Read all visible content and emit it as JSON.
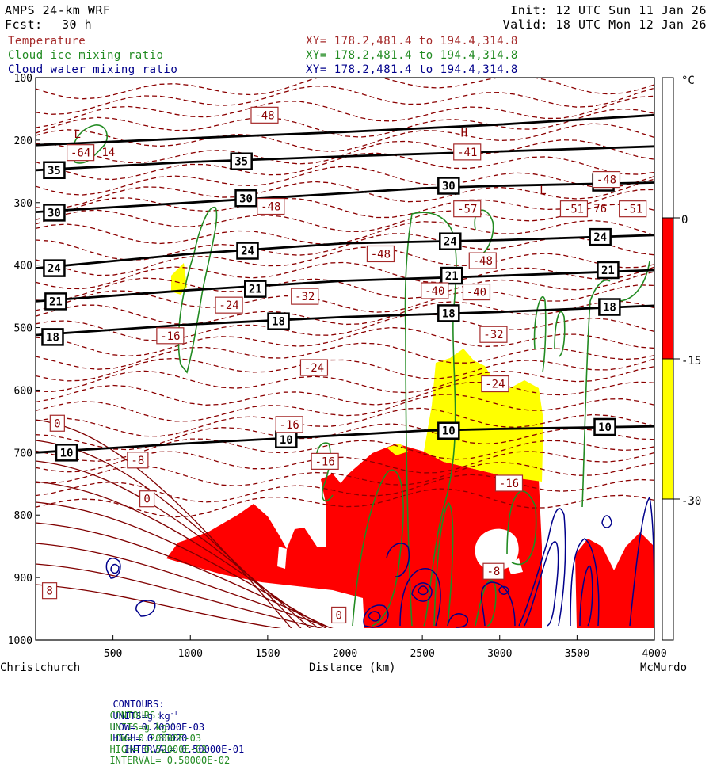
{
  "header": {
    "model": "AMPS 24-km WRF",
    "forecast_label": "Fcst:",
    "forecast_value": "30 h",
    "init": "Init: 12 UTC Sun 11 Jan 26",
    "valid": "Valid: 18 UTC Mon 12 Jan 26",
    "fields": [
      {
        "name": "Temperature",
        "xy": "XY= 178.2,481.4 to 194.4,314.8",
        "color": "#a52a2a"
      },
      {
        "name": "Cloud ice mixing ratio",
        "xy": "XY= 178.2,481.4 to 194.4,314.8",
        "color": "#228b22"
      },
      {
        "name": "Cloud water mixing ratio",
        "xy": "XY= 178.2,481.4 to 194.4,314.8",
        "color": "#00008b"
      }
    ]
  },
  "chart_data": {
    "type": "cross-section",
    "xlabel": "Distance (km)",
    "ylabel": "",
    "x_ticks": [
      500,
      1000,
      1500,
      2000,
      2500,
      3000,
      3500,
      4000
    ],
    "xlim": [
      0,
      4000
    ],
    "x_endpoints": {
      "left": "Christchurch",
      "right": "McMurdo"
    },
    "y_ticks": [
      100,
      200,
      300,
      400,
      500,
      600,
      700,
      800,
      900,
      1000
    ],
    "ylim": [
      100,
      1000
    ],
    "temperature_fill_legend": {
      "unit": "°C",
      "levels": [
        0,
        -15,
        -30
      ],
      "colors": {
        "0_to_-15": "#ff0000",
        "-15_to_-30": "#ffff00",
        "above_0": "#ffffff",
        "below_-30": "#ffffff"
      }
    },
    "theta_lines": [
      {
        "label": "35",
        "points": [
          [
            0,
            208
          ],
          [
            1000,
            197
          ],
          [
            2000,
            187
          ],
          [
            3000,
            175
          ],
          [
            4000,
            160
          ]
        ]
      },
      {
        "label": "35",
        "points": [
          [
            0,
            248
          ],
          [
            1000,
            235
          ],
          [
            2000,
            226
          ],
          [
            3000,
            218
          ],
          [
            4000,
            210
          ]
        ]
      },
      {
        "label": "30",
        "points": [
          [
            0,
            315
          ],
          [
            1000,
            300
          ],
          [
            2000,
            285
          ],
          [
            2500,
            277
          ],
          [
            3000,
            273
          ],
          [
            4000,
            268
          ]
        ]
      },
      {
        "label": "24",
        "points": [
          [
            0,
            405
          ],
          [
            1000,
            382
          ],
          [
            2000,
            365
          ],
          [
            3000,
            360
          ],
          [
            4000,
            352
          ]
        ]
      },
      {
        "label": "21",
        "points": [
          [
            0,
            458
          ],
          [
            1000,
            440
          ],
          [
            2000,
            425
          ],
          [
            3000,
            417
          ],
          [
            4000,
            408
          ]
        ]
      },
      {
        "label": "18",
        "points": [
          [
            0,
            512
          ],
          [
            1000,
            495
          ],
          [
            2000,
            483
          ],
          [
            3000,
            475
          ],
          [
            4000,
            465
          ]
        ]
      },
      {
        "label": "10",
        "points": [
          [
            0,
            700
          ],
          [
            1000,
            685
          ],
          [
            2000,
            672
          ],
          [
            2500,
            665
          ],
          [
            3000,
            662
          ],
          [
            4000,
            658
          ]
        ]
      }
    ],
    "theta_label_positions": [
      {
        "text": "35",
        "x": 120,
        "p": 248
      },
      {
        "text": "35",
        "x": 1330,
        "p": 234
      },
      {
        "text": "30",
        "x": 120,
        "p": 316
      },
      {
        "text": "30",
        "x": 1360,
        "p": 293
      },
      {
        "text": "30",
        "x": 2670,
        "p": 273
      },
      {
        "text": "30",
        "x": 3670,
        "p": 268
      },
      {
        "text": "24",
        "x": 120,
        "p": 405
      },
      {
        "text": "24",
        "x": 1370,
        "p": 377
      },
      {
        "text": "24",
        "x": 2680,
        "p": 362
      },
      {
        "text": "24",
        "x": 3650,
        "p": 355
      },
      {
        "text": "21",
        "x": 130,
        "p": 458
      },
      {
        "text": "21",
        "x": 1420,
        "p": 438
      },
      {
        "text": "21",
        "x": 2690,
        "p": 417
      },
      {
        "text": "21",
        "x": 3700,
        "p": 408
      },
      {
        "text": "18",
        "x": 110,
        "p": 515
      },
      {
        "text": "18",
        "x": 1570,
        "p": 490
      },
      {
        "text": "18",
        "x": 2670,
        "p": 477
      },
      {
        "text": "18",
        "x": 3710,
        "p": 467
      },
      {
        "text": "10",
        "x": 200,
        "p": 700
      },
      {
        "text": "10",
        "x": 1620,
        "p": 679
      },
      {
        "text": "10",
        "x": 2670,
        "p": 665
      },
      {
        "text": "10",
        "x": 3680,
        "p": 659
      }
    ],
    "temperature_labels": [
      {
        "text": "-48",
        "x": 1480,
        "p": 160
      },
      {
        "text": "-48",
        "x": 3690,
        "p": 263
      },
      {
        "text": "-48",
        "x": 1520,
        "p": 306
      },
      {
        "text": "-48",
        "x": 2230,
        "p": 382
      },
      {
        "text": "-48",
        "x": 2890,
        "p": 393
      },
      {
        "text": "-40",
        "x": 2580,
        "p": 441
      },
      {
        "text": "-40",
        "x": 2850,
        "p": 443
      },
      {
        "text": "-32",
        "x": 1740,
        "p": 450
      },
      {
        "text": "-32",
        "x": 2960,
        "p": 511
      },
      {
        "text": "-24",
        "x": 1250,
        "p": 464
      },
      {
        "text": "-24",
        "x": 1800,
        "p": 564
      },
      {
        "text": "-24",
        "x": 2970,
        "p": 590
      },
      {
        "text": "-16",
        "x": 870,
        "p": 513
      },
      {
        "text": "-16",
        "x": 1640,
        "p": 655
      },
      {
        "text": "-16",
        "x": 1870,
        "p": 714
      },
      {
        "text": "-16",
        "x": 3060,
        "p": 749
      },
      {
        "text": "-8",
        "x": 660,
        "p": 712
      },
      {
        "text": "-8",
        "x": 2960,
        "p": 890
      },
      {
        "text": "0",
        "x": 140,
        "p": 653
      },
      {
        "text": "0",
        "x": 720,
        "p": 774
      },
      {
        "text": "0",
        "x": 1960,
        "p": 960
      },
      {
        "text": "8",
        "x": 90,
        "p": 921
      },
      {
        "text": "-64",
        "x": 290,
        "p": 220
      },
      {
        "text": "-41",
        "x": 2790,
        "p": 219
      },
      {
        "text": "-57",
        "x": 2790,
        "p": 310
      },
      {
        "text": "-51",
        "x": 3480,
        "p": 310
      },
      {
        "text": "-51",
        "x": 3860,
        "p": 310
      }
    ],
    "extrema_labels": [
      {
        "text": "L",
        "x": 270,
        "p": 190
      },
      {
        "text": "H",
        "x": 2770,
        "p": 188
      },
      {
        "text": "L",
        "x": 3280,
        "p": 280
      },
      {
        "text": "14",
        "x": 470,
        "p": 219
      },
      {
        "text": "76",
        "x": 3650,
        "p": 309
      }
    ]
  },
  "colorbar": {
    "unit": "°C",
    "ticks": [
      "0",
      "-15",
      "-30"
    ]
  },
  "footer": {
    "line1": {
      "prefix": "CONTOURS:",
      "units": "UNITS=g kg",
      "units_exp": "-1",
      "low": "LOW= 0.20000E-03",
      "high": "HIGH= 0.35020",
      "interval": "INTERVAL= 0.50000E-01",
      "color": "#00008b"
    },
    "line2": {
      "prefix": "CONTOURS:",
      "units": "UNITS=g kg",
      "units_exp": "-1",
      "low": "LOW= 0.20000E-03",
      "high": "HIGH= 0.52000E-02",
      "interval": "INTERVAL= 0.50000E-02",
      "color": "#228b22"
    }
  }
}
